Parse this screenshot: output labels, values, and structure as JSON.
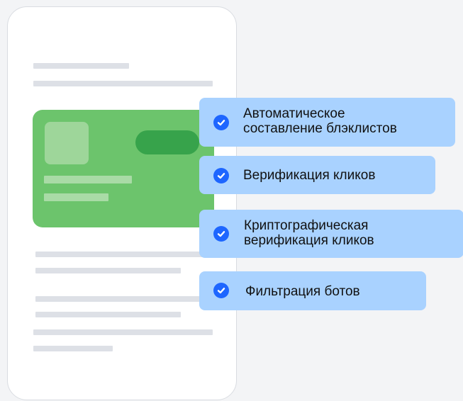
{
  "features": [
    {
      "label": "Автоматическое\nсоставление блэклистов",
      "icon": "check-circle-icon"
    },
    {
      "label": "Верификация кликов",
      "icon": "check-circle-icon"
    },
    {
      "label": "Криптографическая\nверификация кликов",
      "icon": "check-circle-icon"
    },
    {
      "label": "Фильтрация ботов",
      "icon": "check-circle-icon"
    }
  ],
  "colors": {
    "background": "#f3f4f6",
    "phone": "#ffffff",
    "placeholder_line": "#dde0e6",
    "card": "#6cc46c",
    "card_light": "#9ed69a",
    "card_pill": "#37a34b",
    "feature_bg": "#a9d2ff",
    "check_bg": "#1e66ff"
  }
}
